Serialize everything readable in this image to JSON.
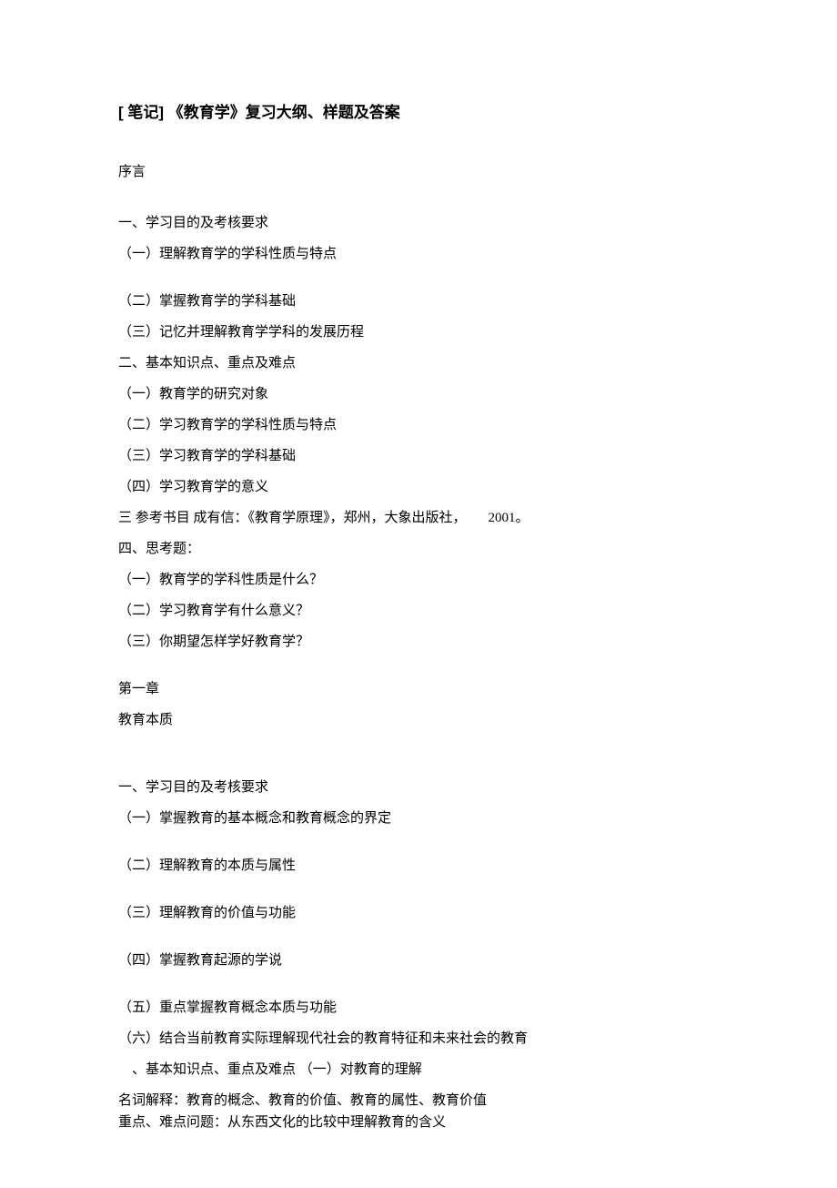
{
  "title": "[ 笔记] 《教育学》复习大纲、样题及答案",
  "preface": {
    "heading": "序言",
    "section1_heading": "一、学习目的及考核要求",
    "section1_items": [
      "（一）理解教育学的学科性质与特点",
      "（二）掌握教育学的学科基础",
      "（三）记忆并理解教育学学科的发展历程"
    ],
    "section2_heading": "二、基本知识点、重点及难点",
    "section2_items": [
      "（一）教育学的研究对象",
      "（二）学习教育学的学科性质与特点",
      "（三）学习教育学的学科基础",
      "（四）学习教育学的意义"
    ],
    "section3_text": "三 参考书目 成有信：《教育学原理》，郑州，大象出版社，",
    "section3_year": "2001。",
    "section4_heading": "四、思考题：",
    "section4_items": [
      "（一）教育学的学科性质是什么？",
      "（二）学习教育学有什么意义？",
      "（三）你期望怎样学好教育学？"
    ]
  },
  "chapter1": {
    "heading": "第一章",
    "subheading": "教育本质",
    "section1_heading": "一、学习目的及考核要求",
    "section1_items": [
      "（一）掌握教育的基本概念和教育概念的界定",
      "（二）理解教育的本质与属性",
      "（三）理解教育的价值与功能",
      "（四）掌握教育起源的学说",
      "（五）重点掌握教育概念本质与功能",
      "（六）结合当前教育实际理解现代社会的教育特征和未来社会的教育"
    ],
    "tail_line1": "、基本知识点、重点及难点 （一）对教育的理解",
    "tail_line2": "名词解释：教育的概念、教育的价值、教育的属性、教育价值",
    "tail_line3": "重点、难点问题：从东西文化的比较中理解教育的含义"
  }
}
